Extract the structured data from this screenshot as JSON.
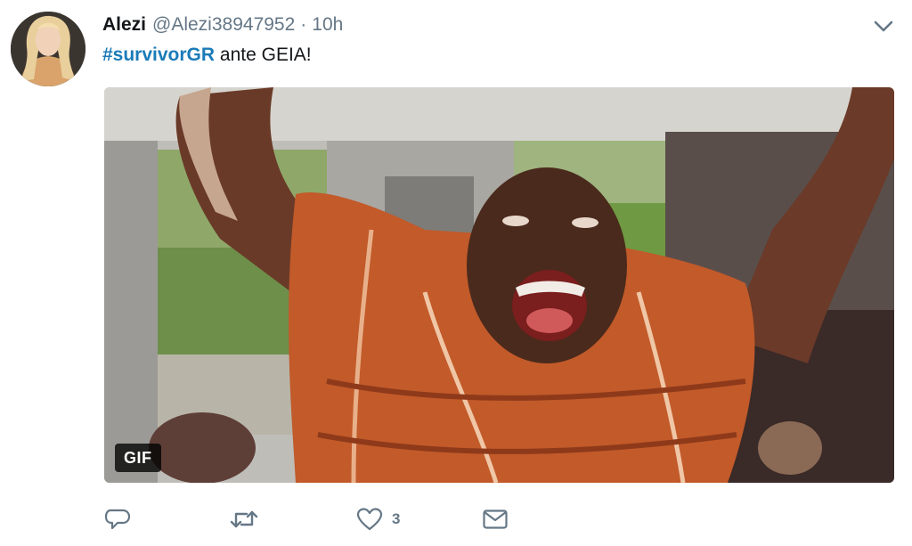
{
  "tweet": {
    "author": {
      "display_name": "Alezi",
      "handle": "@Alezi38947952"
    },
    "separator": "·",
    "timestamp": "10h",
    "text": {
      "hashtag": "#survivorGR",
      "body": " ante GEIA!"
    },
    "media": {
      "badge": "GIF"
    },
    "actions": {
      "reply_icon": "reply-icon",
      "retweet_icon": "retweet-icon",
      "like_icon": "heart-icon",
      "like_count": "3",
      "dm_icon": "envelope-icon"
    }
  },
  "colors": {
    "hashtag": "#1b7bb8",
    "secondary_text": "#657786",
    "primary_text": "#14171a"
  }
}
